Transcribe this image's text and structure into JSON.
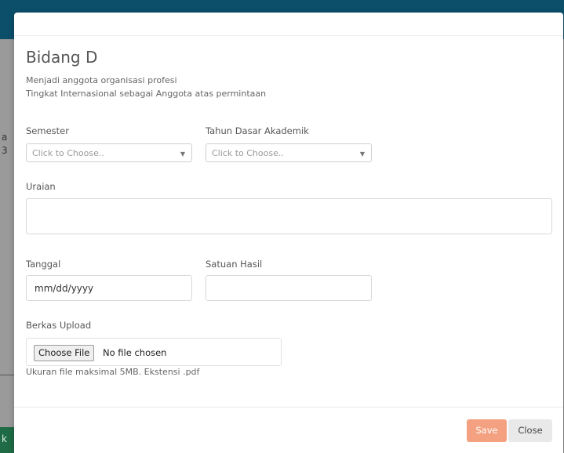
{
  "background": {
    "left_fragments": [
      "a",
      "3",
      "k"
    ]
  },
  "modal": {
    "title": "Bidang D",
    "description_line1": "Menjadi anggota organisasi profesi",
    "description_line2": "Tingkat Internasional sebagai Anggota atas permintaan",
    "form": {
      "semester": {
        "label": "Semester",
        "placeholder": "Click to Choose.."
      },
      "tahun": {
        "label": "Tahun Dasar Akademik",
        "placeholder": "Click to Choose.."
      },
      "uraian": {
        "label": "Uraian",
        "value": ""
      },
      "tanggal": {
        "label": "Tanggal",
        "value": "mm/dd/yyyy"
      },
      "satuan": {
        "label": "Satuan Hasil",
        "value": ""
      },
      "berkas": {
        "label": "Berkas Upload",
        "button": "Choose File",
        "status": "No file chosen",
        "hint": "Ukuran file maksimal 5MB. Ekstensi .pdf"
      }
    },
    "footer": {
      "save_label": "Save",
      "close_label": "Close"
    },
    "colors": {
      "save": "#f4a182",
      "close": "#e9e9e9",
      "topbar": "#0c4f6b"
    }
  }
}
